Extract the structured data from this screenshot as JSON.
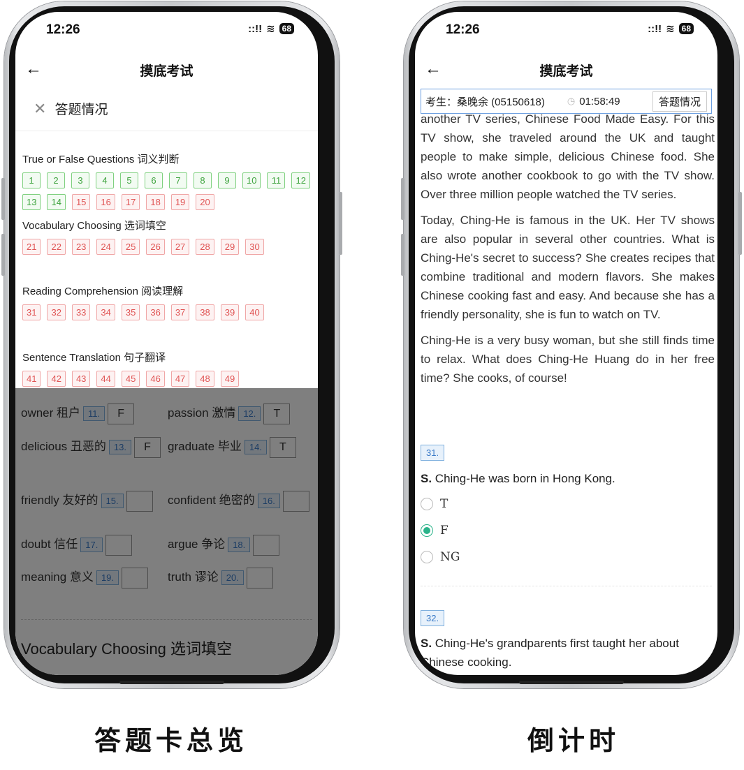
{
  "left_phone": {
    "time": "12:26",
    "signal": "::!!",
    "battery": "68",
    "nav_title": "摸底考试",
    "sheet": {
      "title": "答题情况",
      "groups": [
        {
          "title": "True or False Questions 词义判断",
          "cells": [
            {
              "n": "1",
              "s": "ok"
            },
            {
              "n": "2",
              "s": "ok"
            },
            {
              "n": "3",
              "s": "ok"
            },
            {
              "n": "4",
              "s": "ok"
            },
            {
              "n": "5",
              "s": "ok"
            },
            {
              "n": "6",
              "s": "ok"
            },
            {
              "n": "7",
              "s": "ok"
            },
            {
              "n": "8",
              "s": "ok"
            },
            {
              "n": "9",
              "s": "ok"
            },
            {
              "n": "10",
              "s": "ok"
            },
            {
              "n": "11",
              "s": "ok"
            },
            {
              "n": "12",
              "s": "ok"
            },
            {
              "n": "13",
              "s": "ok"
            },
            {
              "n": "14",
              "s": "ok"
            },
            {
              "n": "15",
              "s": "no"
            },
            {
              "n": "16",
              "s": "no"
            },
            {
              "n": "17",
              "s": "no"
            },
            {
              "n": "18",
              "s": "no"
            },
            {
              "n": "19",
              "s": "no"
            },
            {
              "n": "20",
              "s": "no"
            }
          ]
        },
        {
          "title": "Vocabulary Choosing 选词填空",
          "cells": [
            {
              "n": "21",
              "s": "no"
            },
            {
              "n": "22",
              "s": "no"
            },
            {
              "n": "23",
              "s": "no"
            },
            {
              "n": "24",
              "s": "no"
            },
            {
              "n": "25",
              "s": "no"
            },
            {
              "n": "26",
              "s": "no"
            },
            {
              "n": "27",
              "s": "no"
            },
            {
              "n": "28",
              "s": "no"
            },
            {
              "n": "29",
              "s": "no"
            },
            {
              "n": "30",
              "s": "no"
            }
          ]
        },
        {
          "title": "Reading Comprehension 阅读理解",
          "cells": [
            {
              "n": "31",
              "s": "no"
            },
            {
              "n": "32",
              "s": "no"
            },
            {
              "n": "33",
              "s": "no"
            },
            {
              "n": "34",
              "s": "no"
            },
            {
              "n": "35",
              "s": "no"
            },
            {
              "n": "36",
              "s": "no"
            },
            {
              "n": "37",
              "s": "no"
            },
            {
              "n": "38",
              "s": "no"
            },
            {
              "n": "39",
              "s": "no"
            },
            {
              "n": "40",
              "s": "no"
            }
          ]
        },
        {
          "title": "Sentence Translation 句子翻译",
          "cells": [
            {
              "n": "41",
              "s": "no"
            },
            {
              "n": "42",
              "s": "no"
            },
            {
              "n": "43",
              "s": "no"
            },
            {
              "n": "44",
              "s": "no"
            },
            {
              "n": "45",
              "s": "no"
            },
            {
              "n": "46",
              "s": "no"
            },
            {
              "n": "47",
              "s": "no"
            },
            {
              "n": "48",
              "s": "no"
            },
            {
              "n": "49",
              "s": "no"
            }
          ]
        }
      ]
    },
    "background": {
      "rows": [
        {
          "left": {
            "word": "owner 租户",
            "num": "11.",
            "ans": "F"
          },
          "right": {
            "word": "passion 激情",
            "num": "12.",
            "ans": "T"
          }
        },
        {
          "left": {
            "word": "delicious 丑恶的",
            "num": "13.",
            "ans": "F"
          },
          "right": {
            "word": "graduate 毕业",
            "num": "14.",
            "ans": "T"
          }
        },
        {
          "left": {
            "word": "friendly 友好的",
            "num": "15.",
            "ans": ""
          },
          "right": {
            "word": "confident 绝密的",
            "num": "16.",
            "ans": ""
          }
        },
        {
          "left": {
            "word": "doubt 信任",
            "num": "17.",
            "ans": ""
          },
          "right": {
            "word": "argue 争论",
            "num": "18.",
            "ans": ""
          }
        },
        {
          "left": {
            "word": "meaning 意义",
            "num": "19.",
            "ans": ""
          },
          "right": {
            "word": "truth 谬论",
            "num": "20.",
            "ans": ""
          }
        }
      ],
      "next_section": "Vocabulary Choosing 选词填空"
    },
    "caption": "答题卡总览"
  },
  "right_phone": {
    "time": "12:26",
    "signal": "::!!",
    "battery": "68",
    "nav_title": "摸底考试",
    "student": "考生：桑晚余 (05150618)",
    "timer": "01:58:49",
    "sheet_button": "答题情况",
    "passage": [
      "another TV series, Chinese Food Made Easy. For this TV show, she traveled around the UK and taught people to make simple, delicious Chinese food. She also wrote another cookbook to go with the TV show. Over three million people watched the TV series.",
      "Today, Ching-He is famous in the UK. Her TV shows are also popular in several other countries. What is Ching-He's secret to success? She creates recipes that combine traditional and modern flavors. She makes Chinese cooking fast and easy. And because she has a friendly personality, she is fun to watch on TV.",
      "Ching-He is a very busy woman, but she still finds time to relax. What does Ching-He Huang do in her free time? She cooks, of course!"
    ],
    "q31": {
      "num": "31.",
      "prefix": "S.",
      "text": "Ching-He was born in Hong Kong.",
      "options": [
        "T",
        "F",
        "NG"
      ],
      "selected": "F"
    },
    "q32": {
      "num": "32.",
      "prefix": "S.",
      "text": "Ching-He's grandparents first taught her about Chinese cooking."
    },
    "caption": "倒计时"
  },
  "colors": {
    "correct": "#3ea33e",
    "wrong": "#e05454",
    "accent": "#3b7bc8",
    "radio_on": "#2bb38a"
  }
}
